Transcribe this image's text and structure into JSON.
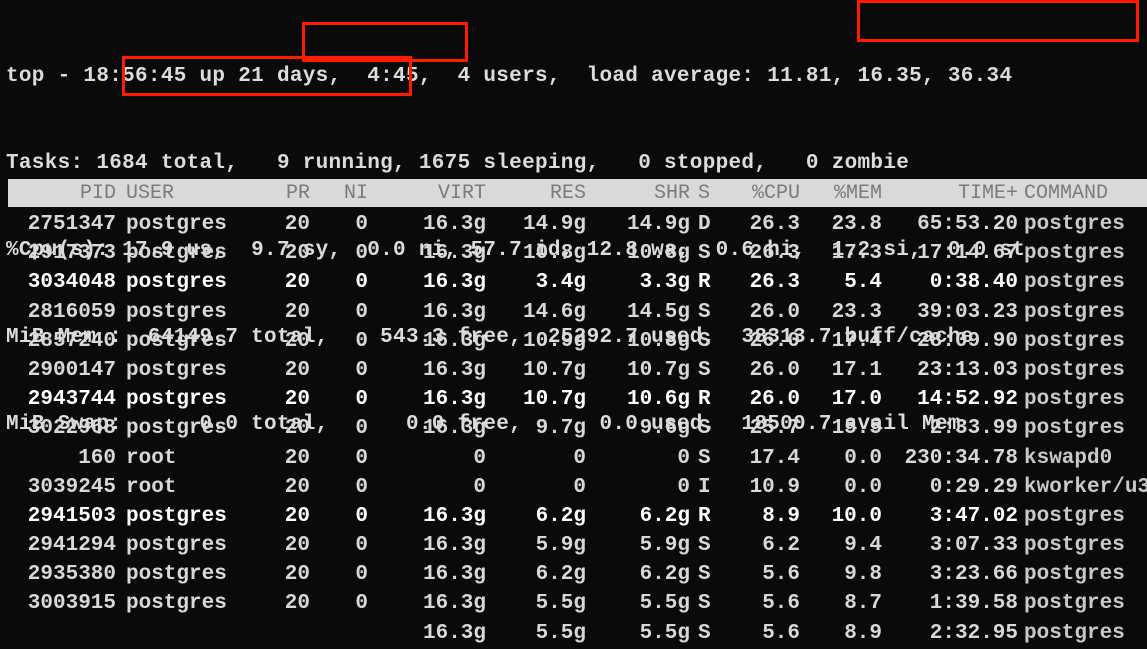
{
  "summary": {
    "line1": "top - 18:56:45 up 21 days,  4:45,  4 users,  load average: 11.81, 16.35, 36.34",
    "line2": "Tasks: 1684 total,   9 running, 1675 sleeping,   0 stopped,   0 zombie",
    "line3": "%Cpu(s): 17.9 us,  9.7 sy,  0.0 ni, 57.7 id, 12.8 wa,  0.6 hi,  1.2 si,  0.0 st",
    "line4": "MiB Mem :  64149.7 total,    543.3 free,  25292.7 used,  38313.7 buff/cache",
    "line5": "MiB Swap:      0.0 total,      0.0 free,      0.0 used.  18500.7 avail Mem"
  },
  "highlights": {
    "color": "#ff1a00",
    "items": [
      "load average: 11.81, 16.35, 36.34",
      "9 running",
      "17.9 us, 9.7 sy"
    ]
  },
  "table": {
    "headers": {
      "pid": "PID",
      "user": "USER",
      "pr": "PR",
      "ni": "NI",
      "virt": "VIRT",
      "res": "RES",
      "shr": "SHR",
      "s": "S",
      "cpu": "%CPU",
      "mem": "%MEM",
      "time": "TIME+",
      "command": "COMMAND"
    },
    "rows": [
      {
        "pid": "2751347",
        "user": "postgres",
        "pr": "20",
        "ni": "0",
        "virt": "16.3g",
        "res": "14.9g",
        "shr": "14.9g",
        "s": "D",
        "cpu": "26.3",
        "mem": "23.8",
        "time": "65:53.20",
        "command": "postgres"
      },
      {
        "pid": "2917373",
        "user": "postgres",
        "pr": "20",
        "ni": "0",
        "virt": "16.3g",
        "res": "10.8g",
        "shr": "10.8g",
        "s": "S",
        "cpu": "26.3",
        "mem": "17.3",
        "time": "17:14.67",
        "command": "postgres"
      },
      {
        "pid": "3034048",
        "user": "postgres",
        "pr": "20",
        "ni": "0",
        "virt": "16.3g",
        "res": "3.4g",
        "shr": "3.3g",
        "s": "R",
        "cpu": "26.3",
        "mem": "5.4",
        "time": "0:38.40",
        "command": "postgres"
      },
      {
        "pid": "2816059",
        "user": "postgres",
        "pr": "20",
        "ni": "0",
        "virt": "16.3g",
        "res": "14.6g",
        "shr": "14.5g",
        "s": "S",
        "cpu": "26.0",
        "mem": "23.3",
        "time": "39:03.23",
        "command": "postgres"
      },
      {
        "pid": "2857240",
        "user": "postgres",
        "pr": "20",
        "ni": "0",
        "virt": "16.3g",
        "res": "10.9g",
        "shr": "10.8g",
        "s": "S",
        "cpu": "26.0",
        "mem": "17.4",
        "time": "28:09.90",
        "command": "postgres"
      },
      {
        "pid": "2900147",
        "user": "postgres",
        "pr": "20",
        "ni": "0",
        "virt": "16.3g",
        "res": "10.7g",
        "shr": "10.7g",
        "s": "S",
        "cpu": "26.0",
        "mem": "17.1",
        "time": "23:13.03",
        "command": "postgres"
      },
      {
        "pid": "2943744",
        "user": "postgres",
        "pr": "20",
        "ni": "0",
        "virt": "16.3g",
        "res": "10.7g",
        "shr": "10.6g",
        "s": "R",
        "cpu": "26.0",
        "mem": "17.0",
        "time": "14:52.92",
        "command": "postgres"
      },
      {
        "pid": "3022968",
        "user": "postgres",
        "pr": "20",
        "ni": "0",
        "virt": "16.3g",
        "res": "9.7g",
        "shr": "9.6g",
        "s": "S",
        "cpu": "25.7",
        "mem": "15.5",
        "time": "2:33.99",
        "command": "postgres"
      },
      {
        "pid": "160",
        "user": "root",
        "pr": "20",
        "ni": "0",
        "virt": "0",
        "res": "0",
        "shr": "0",
        "s": "S",
        "cpu": "17.4",
        "mem": "0.0",
        "time": "230:34.78",
        "command": "kswapd0"
      },
      {
        "pid": "3039245",
        "user": "root",
        "pr": "20",
        "ni": "0",
        "virt": "0",
        "res": "0",
        "shr": "0",
        "s": "I",
        "cpu": "10.9",
        "mem": "0.0",
        "time": "0:29.29",
        "command": "kworker/u3"
      },
      {
        "pid": "2941503",
        "user": "postgres",
        "pr": "20",
        "ni": "0",
        "virt": "16.3g",
        "res": "6.2g",
        "shr": "6.2g",
        "s": "R",
        "cpu": "8.9",
        "mem": "10.0",
        "time": "3:47.02",
        "command": "postgres"
      },
      {
        "pid": "2941294",
        "user": "postgres",
        "pr": "20",
        "ni": "0",
        "virt": "16.3g",
        "res": "5.9g",
        "shr": "5.9g",
        "s": "S",
        "cpu": "6.2",
        "mem": "9.4",
        "time": "3:07.33",
        "command": "postgres"
      },
      {
        "pid": "2935380",
        "user": "postgres",
        "pr": "20",
        "ni": "0",
        "virt": "16.3g",
        "res": "6.2g",
        "shr": "6.2g",
        "s": "S",
        "cpu": "5.6",
        "mem": "9.8",
        "time": "3:23.66",
        "command": "postgres"
      },
      {
        "pid": "3003915",
        "user": "postgres",
        "pr": "20",
        "ni": "0",
        "virt": "16.3g",
        "res": "5.5g",
        "shr": "5.5g",
        "s": "S",
        "cpu": "5.6",
        "mem": "8.7",
        "time": "1:39.58",
        "command": "postgres"
      },
      {
        "pid": "",
        "user": "",
        "pr": "",
        "ni": "",
        "virt": "16.3g",
        "res": "5.5g",
        "shr": "5.5g",
        "s": "S",
        "cpu": "5.6",
        "mem": "8.9",
        "time": "2:32.95",
        "command": "postgres"
      }
    ]
  }
}
